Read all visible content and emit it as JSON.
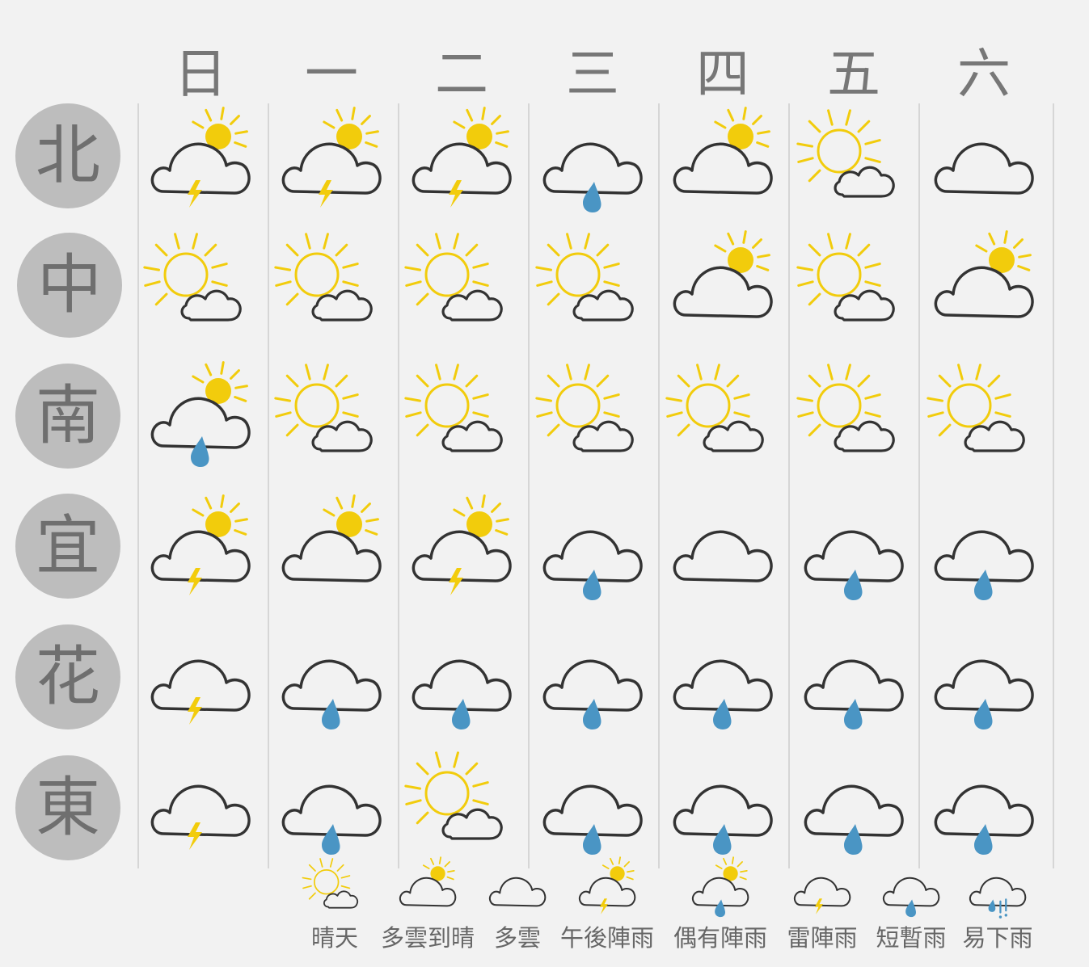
{
  "days": [
    "日",
    "一",
    "二",
    "三",
    "四",
    "五",
    "六"
  ],
  "regions": [
    "北",
    "中",
    "南",
    "宜",
    "花",
    "東"
  ],
  "grid": [
    [
      "thunder-sun",
      "thunder-sun",
      "thunder-sun",
      "rain",
      "cloudy-sun",
      "sunny",
      "cloudy"
    ],
    [
      "sunny",
      "sunny",
      "sunny",
      "sunny",
      "cloudy-sun",
      "sunny",
      "cloudy-sun"
    ],
    [
      "rain-sun",
      "sunny",
      "sunny",
      "sunny",
      "sunny",
      "sunny",
      "sunny"
    ],
    [
      "thunder-sun",
      "cloudy-sun",
      "thunder-sun",
      "rain",
      "cloudy",
      "rain",
      "rain"
    ],
    [
      "thunder",
      "rain",
      "rain",
      "rain",
      "rain",
      "rain",
      "rain"
    ],
    [
      "thunder",
      "rain",
      "sunny",
      "rain",
      "rain",
      "rain",
      "rain"
    ]
  ],
  "legend": [
    {
      "type": "sunny",
      "label": "晴天"
    },
    {
      "type": "cloudy-sun",
      "label": "多雲到晴"
    },
    {
      "type": "cloudy",
      "label": "多雲"
    },
    {
      "type": "thunder-sun",
      "label": "午後陣雨"
    },
    {
      "type": "rain-sun",
      "label": "偶有陣雨"
    },
    {
      "type": "thunder",
      "label": "雷陣雨"
    },
    {
      "type": "rain",
      "label": "短暫雨"
    },
    {
      "type": "showers",
      "label": "易下雨"
    }
  ],
  "colors": {
    "sun": "#f2cc0c",
    "sun_rays": "#f2cc0c",
    "cloud_stroke": "#333333",
    "cloud_fill": "#f2f2f2",
    "rain": "#4a95c4",
    "bolt": "#f2cc0c"
  }
}
